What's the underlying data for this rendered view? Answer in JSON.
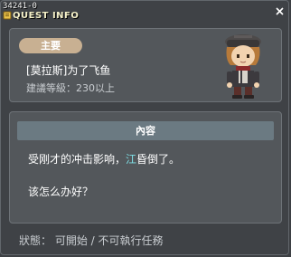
{
  "window": {
    "quest_id": "34241-0",
    "title": "QUEST INFO",
    "close_icon": "close-icon"
  },
  "header": {
    "tag_label": "主要",
    "quest_name": "[莫拉斯]为了飞鱼",
    "level_requirement": "建議等級：230以上",
    "npc_portrait": "npc-character-icon"
  },
  "content": {
    "section_title": "內容",
    "line1_before": "受刚才的冲击影响，",
    "line1_highlight": "江",
    "line1_after": "昏倒了。",
    "line2": "该怎么办好？"
  },
  "status": {
    "text": "狀態： 可開始 / 不可執行任務"
  },
  "colors": {
    "background": "#3f4246",
    "panel": "#53575b",
    "tag": "#c8b092",
    "section_header": "#6b7a82",
    "highlight": "#7fe0e6",
    "title_text": "#f5f1c9"
  }
}
